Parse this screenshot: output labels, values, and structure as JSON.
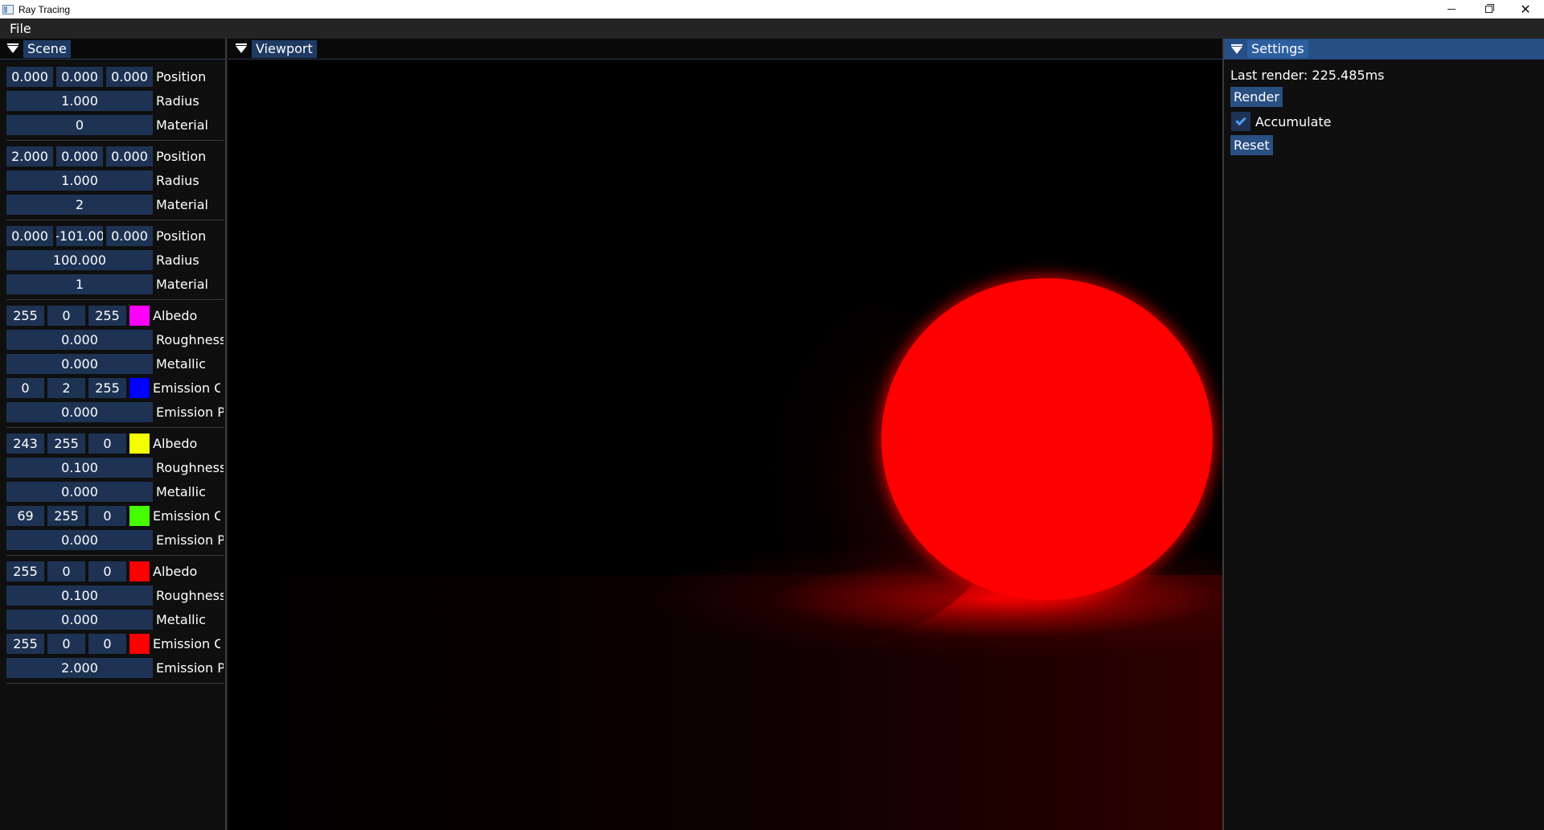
{
  "window": {
    "title": "Ray Tracing",
    "controls": {
      "minimize": "minimize-icon",
      "maximize": "restore-icon",
      "close": "✕"
    }
  },
  "menu": {
    "items": [
      "File"
    ]
  },
  "panels": {
    "scene": {
      "tab": "Scene"
    },
    "viewport": {
      "tab": "Viewport"
    },
    "settings": {
      "tab": "Settings"
    }
  },
  "scene": {
    "spheres": [
      {
        "position": [
          "0.000",
          "0.000",
          "0.000"
        ],
        "position_label": "Position",
        "radius": "1.000",
        "radius_label": "Radius",
        "material": "0",
        "material_label": "Material"
      },
      {
        "position": [
          "2.000",
          "0.000",
          "0.000"
        ],
        "position_label": "Position",
        "radius": "1.000",
        "radius_label": "Radius",
        "material": "2",
        "material_label": "Material"
      },
      {
        "position": [
          "0.000",
          "-101.00",
          "0.000"
        ],
        "position_label": "Position",
        "radius": "100.000",
        "radius_label": "Radius",
        "material": "1",
        "material_label": "Material"
      }
    ],
    "materials": [
      {
        "albedo": [
          "255",
          "0",
          "255"
        ],
        "albedo_color": "#ff00ff",
        "albedo_label": "Albedo",
        "roughness": "0.000",
        "roughness_label": "Roughness",
        "metallic": "0.000",
        "metallic_label": "Metallic",
        "emission_color": [
          "0",
          "2",
          "255"
        ],
        "emission_swatch": "#0002ff",
        "emission_color_label": "Emission C",
        "emission_power": "0.000",
        "emission_power_label": "Emission P"
      },
      {
        "albedo": [
          "243",
          "255",
          "0"
        ],
        "albedo_color": "#f3ff00",
        "albedo_label": "Albedo",
        "roughness": "0.100",
        "roughness_label": "Roughness",
        "metallic": "0.000",
        "metallic_label": "Metallic",
        "emission_color": [
          "69",
          "255",
          "0"
        ],
        "emission_swatch": "#45ff00",
        "emission_color_label": "Emission C",
        "emission_power": "0.000",
        "emission_power_label": "Emission P"
      },
      {
        "albedo": [
          "255",
          "0",
          "0"
        ],
        "albedo_color": "#ff0000",
        "albedo_label": "Albedo",
        "roughness": "0.100",
        "roughness_label": "Roughness",
        "metallic": "0.000",
        "metallic_label": "Metallic",
        "emission_color": [
          "255",
          "0",
          "0"
        ],
        "emission_swatch": "#ff0000",
        "emission_color_label": "Emission C",
        "emission_power": "2.000",
        "emission_power_label": "Emission P"
      }
    ]
  },
  "settings": {
    "last_render": "Last render: 225.485ms",
    "render_button": "Render",
    "accumulate_label": "Accumulate",
    "accumulate_checked": true,
    "reset_button": "Reset"
  },
  "colors": {
    "accent": "#2d5fa0",
    "field_bg": "#1e3354",
    "panel_bg": "#0f0f0f"
  }
}
